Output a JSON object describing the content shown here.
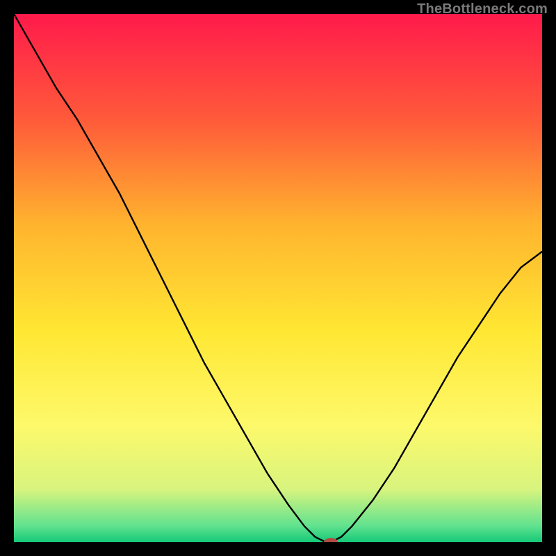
{
  "watermark": "TheBottleneck.com",
  "chart_data": {
    "type": "line",
    "title": "",
    "xlabel": "",
    "ylabel": "",
    "xlim": [
      0,
      100
    ],
    "ylim": [
      0,
      100
    ],
    "grid": false,
    "legend": false,
    "background_gradient": {
      "stops": [
        {
          "offset": 0.0,
          "color": "#ff1a4b"
        },
        {
          "offset": 0.2,
          "color": "#ff5a3a"
        },
        {
          "offset": 0.4,
          "color": "#ffb42e"
        },
        {
          "offset": 0.6,
          "color": "#ffe733"
        },
        {
          "offset": 0.78,
          "color": "#fdf96b"
        },
        {
          "offset": 0.9,
          "color": "#d8f47e"
        },
        {
          "offset": 0.97,
          "color": "#5fe28f"
        },
        {
          "offset": 1.0,
          "color": "#14c877"
        }
      ]
    },
    "series": [
      {
        "name": "bottleneck-curve",
        "x": [
          0,
          4,
          8,
          12,
          16,
          20,
          24,
          28,
          32,
          36,
          40,
          44,
          48,
          52,
          55,
          57,
          59,
          60,
          62,
          64,
          68,
          72,
          76,
          80,
          84,
          88,
          92,
          96,
          100
        ],
        "y": [
          100,
          93,
          86,
          80,
          73,
          66,
          58,
          50,
          42,
          34,
          27,
          20,
          13,
          7,
          3,
          1,
          0,
          0,
          1,
          3,
          8,
          14,
          21,
          28,
          35,
          41,
          47,
          52,
          55
        ]
      }
    ],
    "marker": {
      "name": "optimal-point",
      "x": 60,
      "y": 0,
      "color": "#b24a45",
      "rx": 10,
      "ry": 6
    }
  }
}
